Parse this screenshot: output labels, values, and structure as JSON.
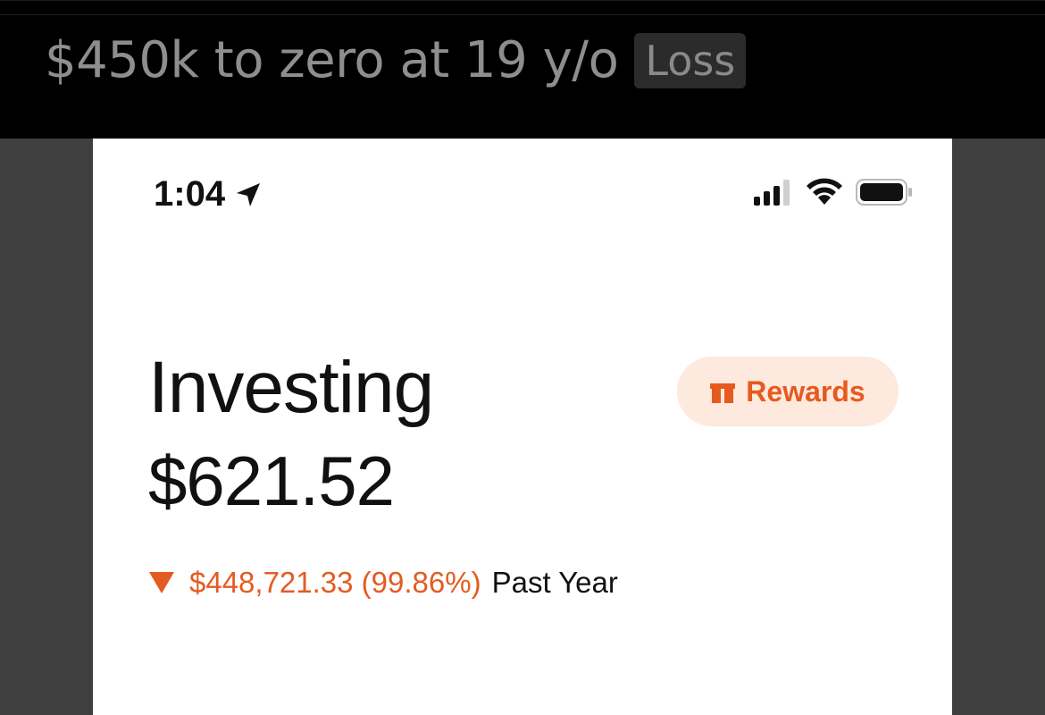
{
  "header": {
    "title": "$450k to zero at 19 y/o",
    "tag": "Loss"
  },
  "status_bar": {
    "time": "1:04"
  },
  "investing": {
    "title": "Investing",
    "balance": "$621.52",
    "change_amount": "$448,721.33 (99.86%)",
    "change_period": "Past Year",
    "rewards_label": "Rewards"
  },
  "colors": {
    "accent": "#e65a1d",
    "rewards_bg": "#fde9de",
    "loss": "#e35c22"
  },
  "icons": {
    "location": "location-arrow-icon",
    "signal": "cellular-signal-icon",
    "wifi": "wifi-icon",
    "battery": "battery-icon",
    "gift": "gift-icon",
    "down": "down-triangle-icon"
  }
}
